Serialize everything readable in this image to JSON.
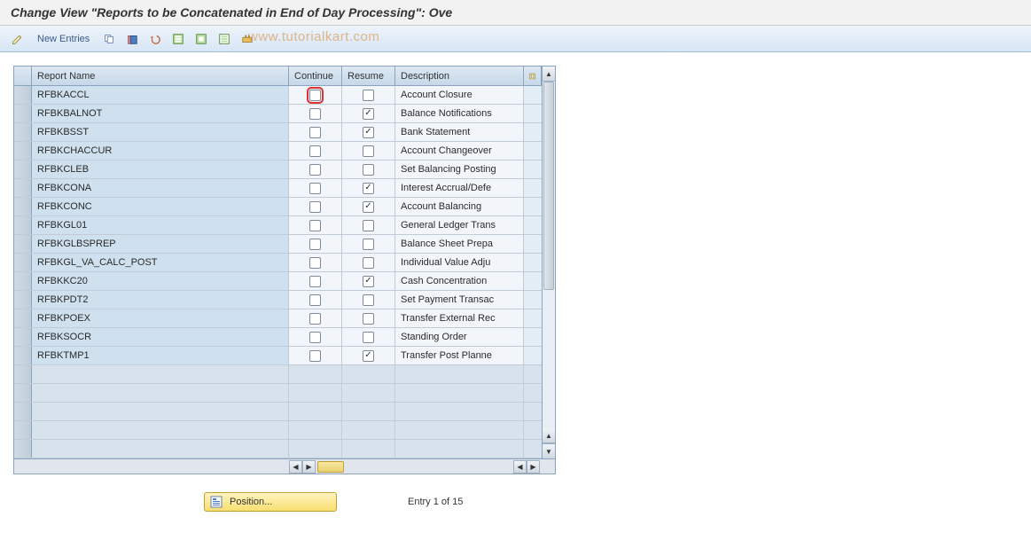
{
  "title": "Change View \"Reports to be Concatenated in End of Day Processing\": Ove",
  "toolbar": {
    "new_entries": "New Entries"
  },
  "watermark": "www.tutorialkart.com",
  "columns": {
    "name": "Report Name",
    "cont": "Continue",
    "res": "Resume",
    "desc": "Description"
  },
  "rows": [
    {
      "name": "RFBKACCL",
      "cont": false,
      "res": false,
      "desc": "Account Closure",
      "focus": true
    },
    {
      "name": "RFBKBALNOT",
      "cont": false,
      "res": true,
      "desc": "Balance Notifications"
    },
    {
      "name": "RFBKBSST",
      "cont": false,
      "res": true,
      "desc": "Bank Statement"
    },
    {
      "name": "RFBKCHACCUR",
      "cont": false,
      "res": false,
      "desc": "Account Changeover"
    },
    {
      "name": "RFBKCLEB",
      "cont": false,
      "res": false,
      "desc": "Set Balancing Posting"
    },
    {
      "name": "RFBKCONA",
      "cont": false,
      "res": true,
      "desc": "Interest Accrual/Defe"
    },
    {
      "name": "RFBKCONC",
      "cont": false,
      "res": true,
      "desc": "Account Balancing"
    },
    {
      "name": "RFBKGL01",
      "cont": false,
      "res": false,
      "desc": "General Ledger Trans"
    },
    {
      "name": "RFBKGLBSPREP",
      "cont": false,
      "res": false,
      "desc": "Balance Sheet Prepa"
    },
    {
      "name": "RFBKGL_VA_CALC_POST",
      "cont": false,
      "res": false,
      "desc": "Individual Value Adju"
    },
    {
      "name": "RFBKKC20",
      "cont": false,
      "res": true,
      "desc": "Cash Concentration"
    },
    {
      "name": "RFBKPDT2",
      "cont": false,
      "res": false,
      "desc": "Set Payment Transac"
    },
    {
      "name": "RFBKPOEX",
      "cont": false,
      "res": false,
      "desc": "Transfer External Rec"
    },
    {
      "name": "RFBKSOCR",
      "cont": false,
      "res": false,
      "desc": "Standing Order"
    },
    {
      "name": "RFBKTMP1",
      "cont": false,
      "res": true,
      "desc": "Transfer Post Planne"
    }
  ],
  "empty_rows": 5,
  "position_button": "Position...",
  "entry_label": "Entry 1 of 15"
}
